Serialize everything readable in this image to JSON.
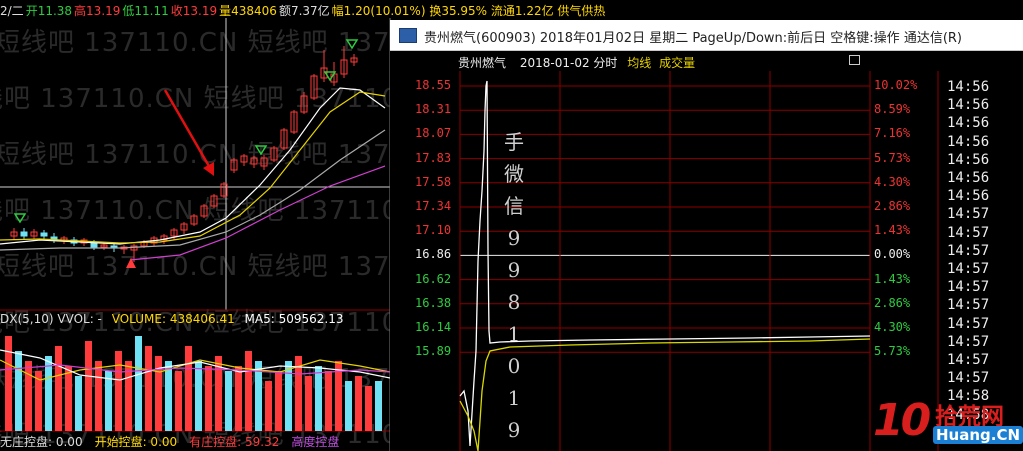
{
  "left_panel": {
    "stats": [
      {
        "label": "2/二",
        "value": "",
        "color": "#dddddd"
      },
      {
        "label": "开",
        "value": "11.38",
        "color": "#2ecc40"
      },
      {
        "label": "高",
        "value": "13.19",
        "color": "#ff3b3b"
      },
      {
        "label": "低",
        "value": "11.11",
        "color": "#2ecc40"
      },
      {
        "label": "收",
        "value": "13.19",
        "color": "#ff3b3b"
      },
      {
        "label": "量",
        "value": "438406",
        "color": "#ffd700"
      },
      {
        "label": "额",
        "value": "7.37亿",
        "color": "#dddddd"
      }
    ],
    "stats_overflow": "幅1.20(10.01%) 换35.95% 流通1.22亿 供气供热",
    "volume_header": {
      "indicator": "DX(5,10) VVOL: -",
      "volume": "VOLUME: 438406.41",
      "ma5": "MA5: 509562.13"
    },
    "bottom_bar": [
      {
        "text": "无庄控盘: 0.00",
        "color": "#dddddd"
      },
      {
        "text": "开始控盘: 0.00",
        "color": "#ffd700"
      },
      {
        "text": "有庄控盘: 59.32",
        "color": "#ff3b3b"
      },
      {
        "text": "高度控盘",
        "color": "#c04de0"
      }
    ]
  },
  "window": {
    "title": "贵州燃气(600903) 2018年01月02日 星期二 PageUp/Down:前后日 空格键:操作 通达信(R)",
    "sub_header": {
      "stock": "贵州燃气",
      "date": "2018-01-02 分时",
      "avg_label": "均线",
      "vol_label": "成交量"
    },
    "price_ticks": [
      "18.55",
      "18.31",
      "18.07",
      "17.83",
      "17.58",
      "17.34",
      "17.10",
      "16.86",
      "16.62",
      "16.38",
      "16.14",
      "15.89"
    ],
    "pct_ticks": [
      "10.02%",
      "8.59%",
      "7.16%",
      "5.73%",
      "4.30%",
      "2.86%",
      "1.43%",
      "0.00%",
      "1.43%",
      "2.86%",
      "4.30%",
      "5.73%"
    ],
    "base_index": 7,
    "vertical_text": [
      "手",
      "微",
      "信",
      "9",
      "9",
      "8",
      "1",
      "0",
      "1",
      "9"
    ],
    "time_col": [
      "14:56",
      "14:56",
      "14:56",
      "14:56",
      "14:56",
      "14:56",
      "14:56",
      "14:57",
      "14:57",
      "14:57",
      "14:57",
      "14:57",
      "14:57",
      "14:57",
      "14:57",
      "14:57",
      "14:57",
      "14:58",
      "14:58",
      "14:58"
    ],
    "intraday": {
      "pre_close": 16.86,
      "price_line_color": "#ffffff",
      "avg_line_color": "#d8d800"
    }
  },
  "watermark": {
    "text": "短线吧 137110.CN 短线吧 137110.CN 短线吧 137110.CN 短线吧 137110.CN 短线吧 137110.CN"
  },
  "logo": {
    "number": "10",
    "cn_name": "拾荒网",
    "domain": "Huang",
    "tld": ".CN"
  },
  "colors": {
    "up": "#ff3b3b",
    "down": "#2ecc40",
    "gridline": "#8b0000",
    "ma_white": "#ffffff",
    "ma_yellow": "#e6d200",
    "ma_magenta": "#d040d0",
    "vol_cyan": "#6fe3f5"
  }
}
